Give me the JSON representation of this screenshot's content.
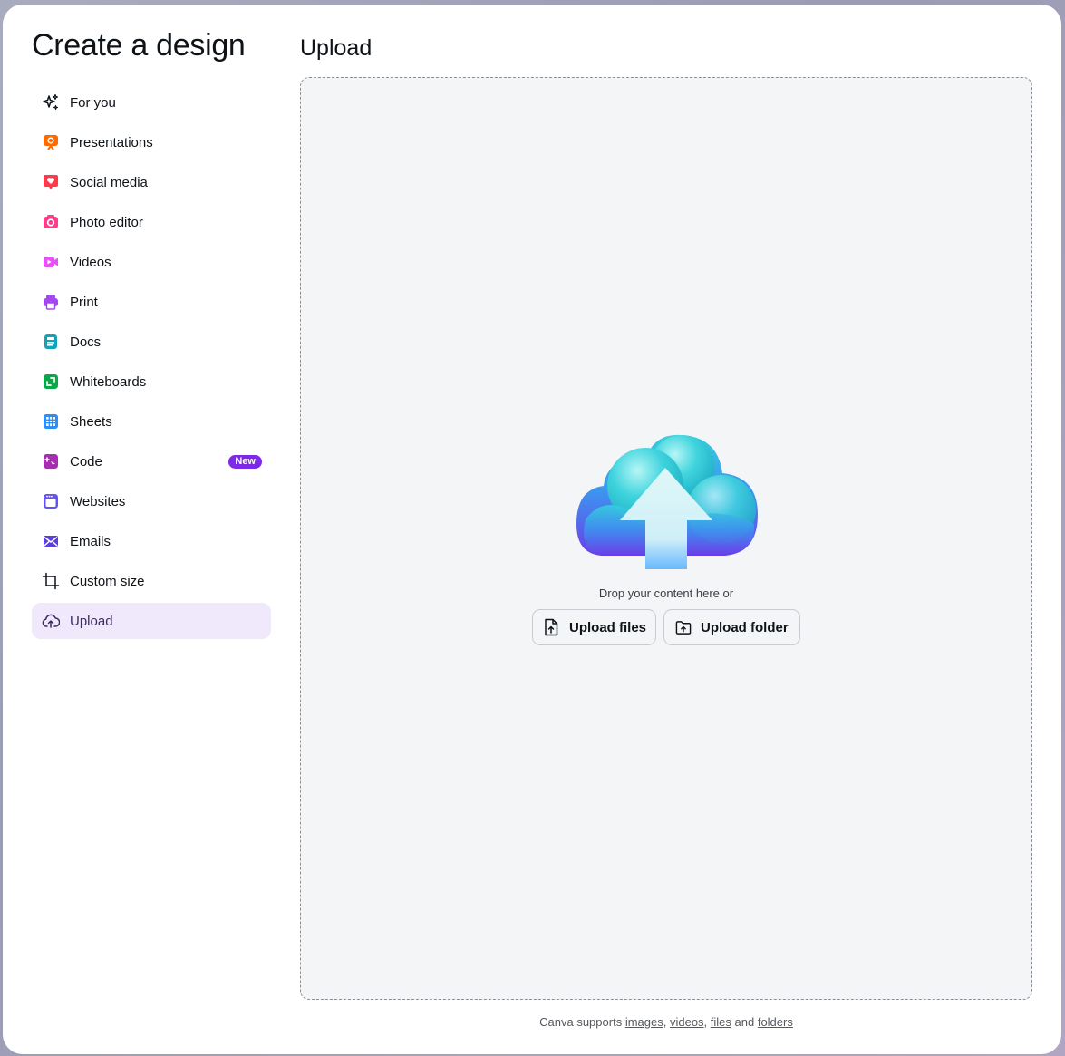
{
  "dialog": {
    "title": "Create a design"
  },
  "nav": {
    "items": [
      {
        "label": "For you",
        "icon": "sparkle-icon"
      },
      {
        "label": "Presentations",
        "icon": "presentation-icon",
        "color": "#ff6a00"
      },
      {
        "label": "Social media",
        "icon": "heart-icon",
        "color": "#ff3b4b"
      },
      {
        "label": "Photo editor",
        "icon": "camera-icon",
        "color": "#ff3d8b"
      },
      {
        "label": "Videos",
        "icon": "video-icon",
        "color": "#e950f7"
      },
      {
        "label": "Print",
        "icon": "printer-icon",
        "color": "#a347f0"
      },
      {
        "label": "Docs",
        "icon": "doc-icon",
        "color": "#13a3b5"
      },
      {
        "label": "Whiteboards",
        "icon": "whiteboard-icon",
        "color": "#0ba84a"
      },
      {
        "label": "Sheets",
        "icon": "sheets-icon",
        "color": "#2c8ef8"
      },
      {
        "label": "Code",
        "icon": "code-icon",
        "color": "#a52fb0",
        "badge": "New"
      },
      {
        "label": "Websites",
        "icon": "website-icon",
        "color": "#6453f5"
      },
      {
        "label": "Emails",
        "icon": "email-icon",
        "color": "#5a3ee0"
      },
      {
        "label": "Custom size",
        "icon": "custom-size-icon"
      },
      {
        "label": "Upload",
        "icon": "upload-cloud-icon",
        "active": true
      }
    ]
  },
  "main": {
    "title": "Upload",
    "drop_text": "Drop your content here or",
    "upload_files_label": "Upload files",
    "upload_folder_label": "Upload folder"
  },
  "footer": {
    "prefix": "Canva supports ",
    "images": "images",
    "sep1": ", ",
    "videos": "videos",
    "sep2": ", ",
    "files": "files",
    "and": " and ",
    "folders": "folders"
  },
  "colors": {
    "accent": "#7d2ae8",
    "active_bg": "#efe9fb",
    "dropzone_bg": "#f4f5f7"
  }
}
